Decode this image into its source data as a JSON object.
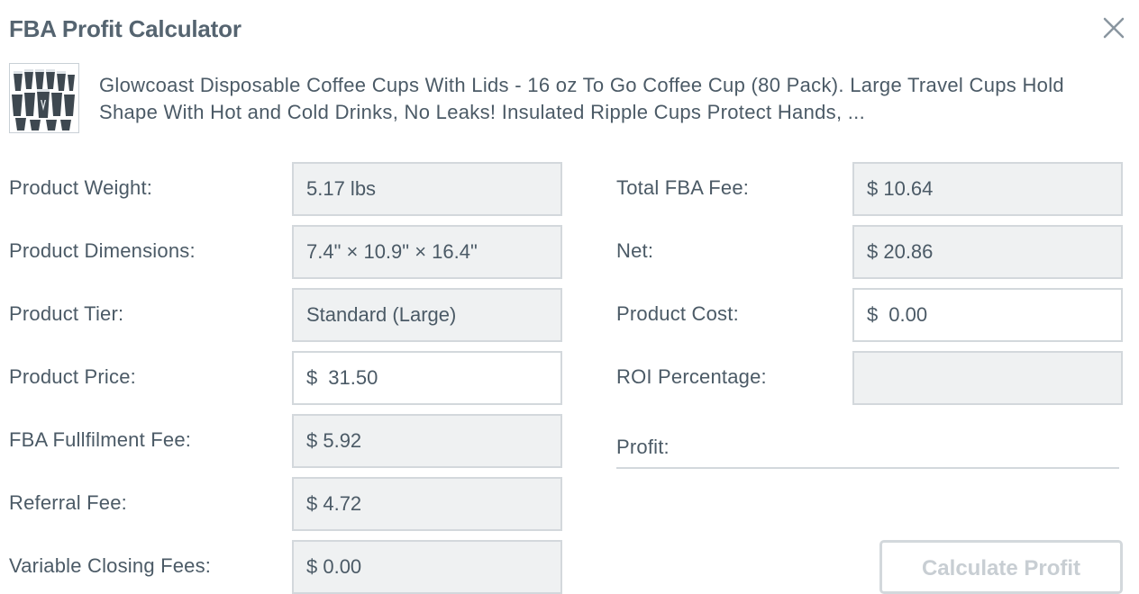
{
  "header": {
    "title": "FBA Profit Calculator",
    "close_icon": "close-icon"
  },
  "product": {
    "thumbnail_icon": "coffee-cups-image",
    "name": "Glowcoast Disposable Coffee Cups With Lids - 16 oz To Go Coffee Cup (80 Pack). Large Travel Cups Hold Shape With Hot and Cold Drinks, No Leaks! Insulated Ripple Cups Protect Hands, ..."
  },
  "left_fields": {
    "weight": {
      "label": "Product Weight:",
      "value": "5.17 lbs"
    },
    "dimensions": {
      "label": "Product Dimensions:",
      "value": "7.4\" × 10.9\" × 16.4\""
    },
    "tier": {
      "label": "Product Tier:",
      "value": "Standard (Large)"
    },
    "price": {
      "label": "Product Price:",
      "currency": "$",
      "value": "31.50"
    },
    "fulfilment_fee": {
      "label": "FBA Fullfilment Fee:",
      "value": "$ 5.92"
    },
    "referral_fee": {
      "label": "Referral Fee:",
      "value": "$ 4.72"
    },
    "closing_fees": {
      "label": "Variable Closing Fees:",
      "value": "$ 0.00"
    }
  },
  "right_fields": {
    "total_fee": {
      "label": "Total FBA Fee:",
      "value": "$ 10.64"
    },
    "net": {
      "label": "Net:",
      "value": "$ 20.86"
    },
    "cost": {
      "label": "Product Cost:",
      "currency": "$",
      "value": "0.00"
    },
    "roi": {
      "label": "ROI Percentage:",
      "value": ""
    },
    "profit": {
      "label": "Profit:",
      "value": ""
    }
  },
  "actions": {
    "calculate_label": "Calculate Profit"
  },
  "colors": {
    "text": "#4b5a66",
    "field_bg": "#eff1f2",
    "border": "#d3d8dc",
    "disabled_text": "#c8ced3"
  }
}
